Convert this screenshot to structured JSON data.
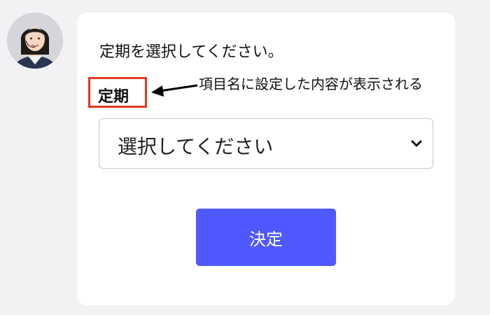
{
  "chat": {
    "avatar_icon": "operator-avatar"
  },
  "form": {
    "prompt": "定期を選択してください。",
    "field_label": "定期",
    "select_value": "選択してください",
    "submit_label": "決定"
  },
  "annotation": {
    "text": "項目名に設定した内容が表示される",
    "highlight_color": "#e03a1f"
  },
  "colors": {
    "accent": "#5059ff",
    "background": "#f2f2f4"
  }
}
